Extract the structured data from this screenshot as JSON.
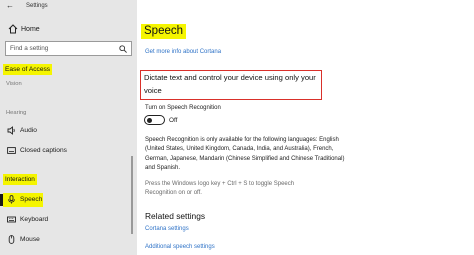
{
  "window": {
    "title": "Settings",
    "back_glyph": "←"
  },
  "sidebar": {
    "home_label": "Home",
    "search_placeholder": "Find a setting",
    "section_title": "Ease of Access",
    "categories": {
      "vision": "Vision",
      "hearing": "Hearing",
      "interaction": "Interaction"
    },
    "items": [
      {
        "label": "Audio",
        "icon": "speaker-icon"
      },
      {
        "label": "Closed captions",
        "icon": "closed-captions-icon"
      },
      {
        "label": "Speech",
        "icon": "microphone-icon",
        "selected": true
      },
      {
        "label": "Keyboard",
        "icon": "keyboard-icon"
      },
      {
        "label": "Mouse",
        "icon": "mouse-icon"
      }
    ]
  },
  "main": {
    "title": "Speech",
    "top_link": "Get more info about Cortana",
    "section_heading": "Dictate text and control your device using only your voice",
    "toggle": {
      "label": "Turn on Speech Recognition",
      "state": "Off",
      "on": false
    },
    "availability_note": "Speech Recognition is only available for the following languages: English (United States, United Kingdom, Canada, India, and Australia), French, German, Japanese, Mandarin (Chinese Simplified and Chinese Traditional) and Spanish.",
    "shortcut_hint": "Press the Windows logo key + Ctrl + S to toggle Speech Recognition on or off.",
    "related_heading": "Related settings",
    "related_links": [
      "Cortana settings",
      "Additional speech settings"
    ]
  },
  "colors": {
    "highlight": "#f5f500",
    "link": "#2f73c7",
    "box_border": "#d9302a",
    "sidebar_bg": "#e6e6e6"
  }
}
